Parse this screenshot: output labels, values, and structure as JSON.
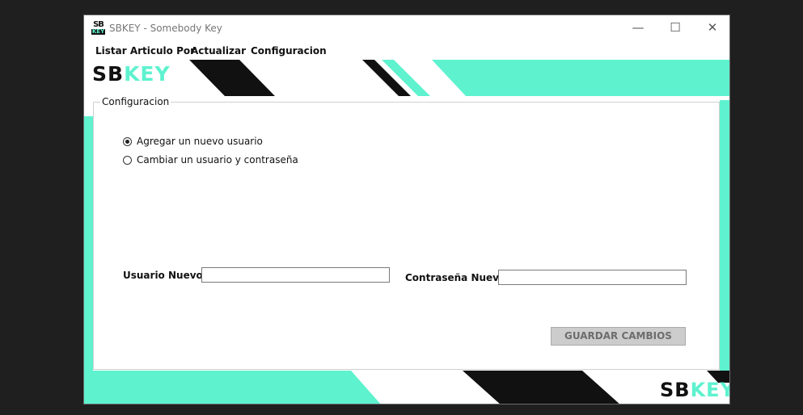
{
  "window": {
    "title": "SBKEY - Somebody Key",
    "icon_text_top": "SB",
    "icon_text_bottom": "KEY",
    "controls": {
      "minimize": "—",
      "maximize": "☐",
      "close": "✕"
    }
  },
  "menu": {
    "items": [
      {
        "label": "Listar Articulo Por"
      },
      {
        "label": "Actualizar"
      },
      {
        "label": "Configuracion"
      }
    ]
  },
  "banner": {
    "logo_dark": "SB",
    "logo_accent": "KEY"
  },
  "colors": {
    "accent": "#5ef2cf",
    "dark": "#111111",
    "background": "#1f1f1f"
  },
  "config": {
    "group_title": "Configuracion",
    "radio_options": [
      {
        "label": "Agregar un nuevo usuario",
        "checked": true
      },
      {
        "label": "Cambiar un usuario y contraseña",
        "checked": false
      }
    ],
    "new_user_label": "Usuario Nuevo",
    "new_user_value": "",
    "new_password_label": "Contraseña Nueva",
    "new_password_value": "",
    "save_button": "GUARDAR CAMBIOS"
  }
}
